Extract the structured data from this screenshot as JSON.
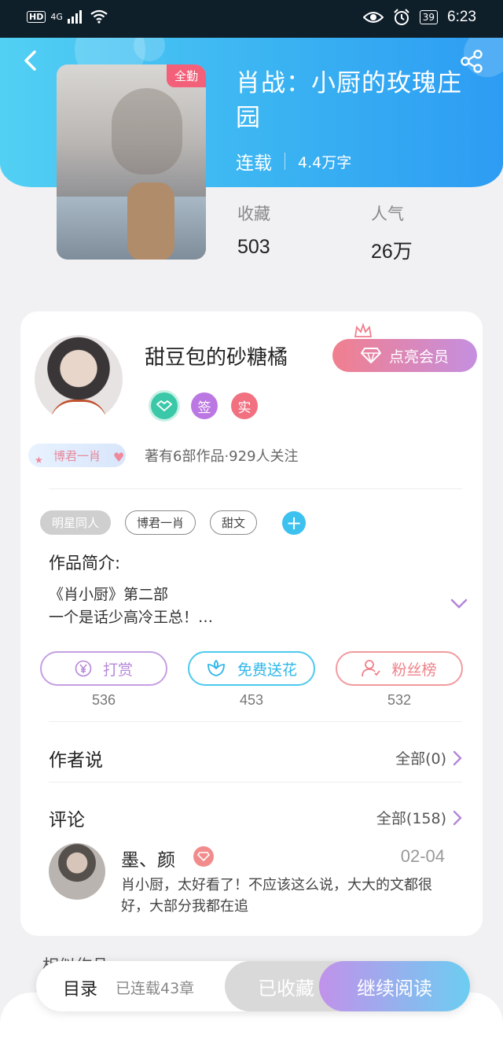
{
  "status_bar": {
    "network": "4G",
    "hd": "HD",
    "battery": "39",
    "time": "6:23"
  },
  "book": {
    "title": "肖战：小厨的玫瑰庄园",
    "cover_badge": "全勤",
    "status": "连载",
    "words": "4.4万字",
    "stats": [
      {
        "label": "收藏",
        "value": "503"
      },
      {
        "label": "人气",
        "value": "26万"
      }
    ]
  },
  "author": {
    "name": "甜豆包的砂糖橘",
    "vip_button": "点亮会员",
    "badges": {
      "sign": "签",
      "real": "实"
    },
    "fan_tag": "博君一肖",
    "info": "著有6部作品·929人关注"
  },
  "tags": [
    "明星同人",
    "博君一肖",
    "甜文"
  ],
  "add_tag": "+",
  "intro": {
    "title": "作品简介:",
    "line1": "《肖小厨》第二部",
    "line2": "一个是话少高冷王总！…"
  },
  "actions": [
    {
      "label": "打赏",
      "count": "536",
      "icon": "yen-icon"
    },
    {
      "label": "免费送花",
      "count": "453",
      "icon": "flower-icon"
    },
    {
      "label": "粉丝榜",
      "count": "532",
      "icon": "user-icon"
    }
  ],
  "author_says": {
    "title": "作者说",
    "link": "全部(0)"
  },
  "comments": {
    "title": "评论",
    "link": "全部(158)",
    "items": [
      {
        "user": "墨、颜",
        "date": "02-04",
        "text": "肖小厨，太好看了！不应该这么说，大大的文都很好，大部分我都在追"
      }
    ]
  },
  "similar": {
    "title": "相似作品"
  },
  "bottom_bar": {
    "toc": "目录",
    "progress": "已连载43章",
    "collected": "已收藏",
    "read": "继续阅读"
  },
  "colors": {
    "header_start": "#52d0f3",
    "header_end": "#2d9cf3",
    "vip_gradient_start": "#f17f8e",
    "vip_gradient_end": "#c58fe0",
    "reward": "#b486d8",
    "flower": "#2fb7e9",
    "fans": "#ee8189"
  }
}
